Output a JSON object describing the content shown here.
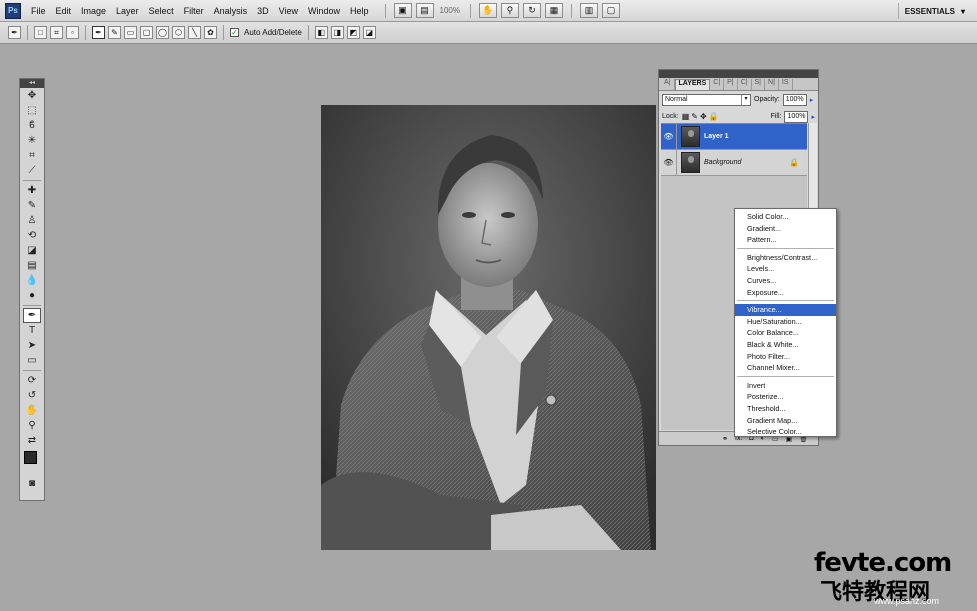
{
  "app": {
    "logo": "Ps"
  },
  "menu": [
    "File",
    "Edit",
    "Image",
    "Layer",
    "Select",
    "Filter",
    "Analysis",
    "3D",
    "View",
    "Window",
    "Help"
  ],
  "menubar": {
    "zoom": "100%",
    "workspace": "ESSENTIALS"
  },
  "options": {
    "auto_add_delete_label": "Auto Add/Delete",
    "auto_add_delete_checked": true
  },
  "layers_panel": {
    "tabs": [
      "A|",
      "LAYERS",
      "C|",
      "P|",
      "C|",
      "S|",
      "N|",
      "IS"
    ],
    "active_tab": "LAYERS",
    "blend_mode": "Normal",
    "opacity_label": "Opacity:",
    "opacity": "100%",
    "lock_label": "Lock:",
    "fill_label": "Fill:",
    "fill": "100%",
    "layers": [
      {
        "name": "Layer 1",
        "selected": true,
        "locked": false
      },
      {
        "name": "Background",
        "selected": false,
        "locked": true
      }
    ],
    "footer_fx": "fx."
  },
  "adjustment_menu": {
    "groups": [
      [
        "Solid Color...",
        "Gradient...",
        "Pattern..."
      ],
      [
        "Brightness/Contrast...",
        "Levels...",
        "Curves...",
        "Exposure..."
      ],
      [
        "Vibrance...",
        "Hue/Saturation...",
        "Color Balance...",
        "Black & White...",
        "Photo Filter...",
        "Channel Mixer..."
      ],
      [
        "Invert",
        "Posterize...",
        "Threshold...",
        "Gradient Map...",
        "Selective Color..."
      ]
    ],
    "highlighted": "Vibrance..."
  },
  "watermark": {
    "line1": "fevte.com",
    "line2": "飞特教程网",
    "line3": "www.psahz.com"
  },
  "colors": {
    "selection": "#3063c9",
    "canvas_bg": "#a7a7a7",
    "foreground": "#2b2b2b",
    "background": "#ffffff"
  }
}
